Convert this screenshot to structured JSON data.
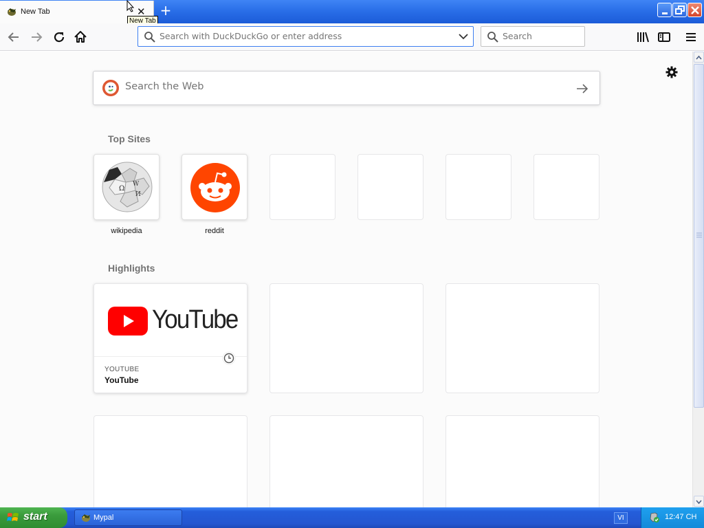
{
  "tab": {
    "title": "New Tab",
    "tooltip": "New Tab"
  },
  "nav": {
    "url_placeholder": "Search with DuckDuckGo or enter address",
    "search_placeholder": "Search"
  },
  "newtab": {
    "websearch_placeholder": "Search the Web",
    "top_sites_title": "Top Sites",
    "top_sites": [
      {
        "label": "wikipedia"
      },
      {
        "label": "reddit"
      }
    ],
    "highlights_title": "Highlights",
    "highlights": [
      {
        "source": "YOUTUBE",
        "title": "YouTube",
        "logo_text": "YouTube"
      }
    ]
  },
  "taskbar": {
    "start_label": "start",
    "task_label": "Mypal",
    "lang": "VI",
    "clock": "12:47 CH"
  },
  "colors": {
    "titlebar": "#2a6fe8",
    "taskbar": "#245edb",
    "start": "#3a9b3c",
    "reddit": "#ff4500",
    "youtube": "#ff0000",
    "ddg": "#de5833"
  }
}
